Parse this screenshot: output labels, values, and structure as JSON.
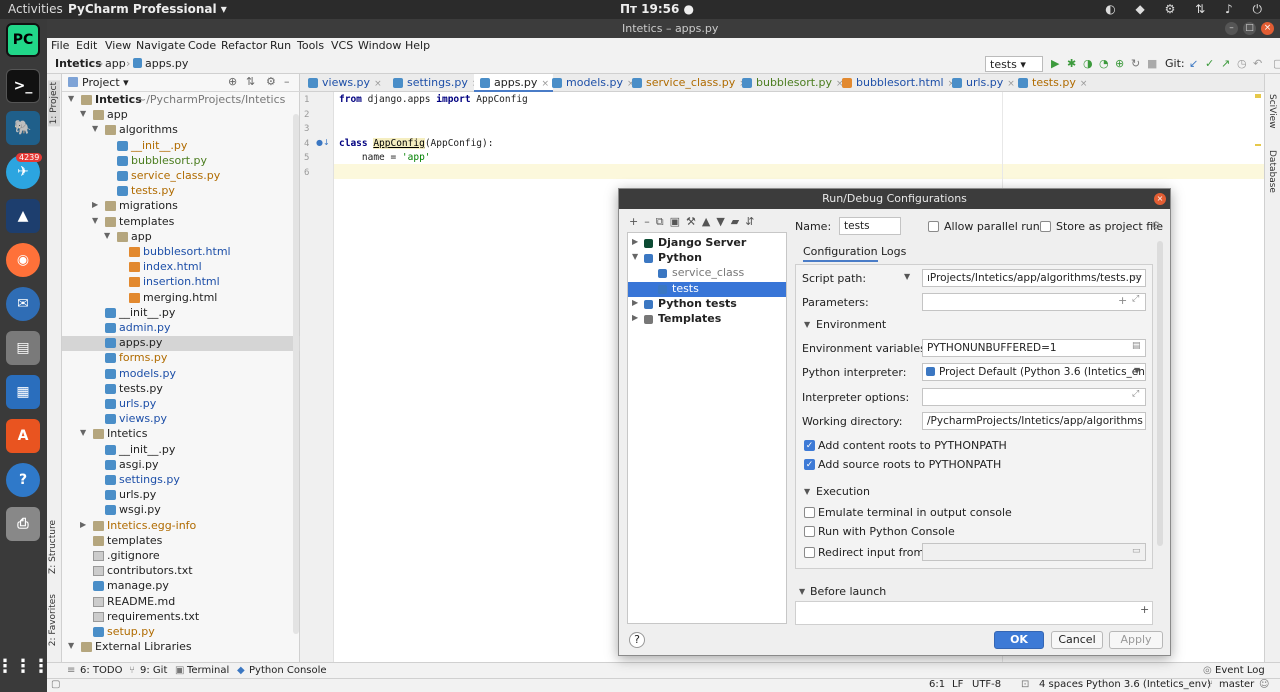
{
  "topbar": {
    "activities": "Activities",
    "app_name": "PyCharm Professional ▾",
    "clock": "Пт 19:56 ●"
  },
  "dock": {
    "telegram_badge": "4239",
    "pycharm_label": "PC"
  },
  "window": {
    "title": "Intetics – apps.py"
  },
  "menu": [
    "File",
    "Edit",
    "View",
    "Navigate",
    "Code",
    "Refactor",
    "Run",
    "Tools",
    "VCS",
    "Window",
    "Help"
  ],
  "breadcrumb": [
    "Intetics",
    "app",
    "apps.py"
  ],
  "run_config": {
    "selected": "tests ▾",
    "git_label": "Git:"
  },
  "left_tabs": {
    "project": "1: Project",
    "structure": "Z: Structure",
    "favorites": "2: Favorites"
  },
  "right_tabs": {
    "sciview": "SciView",
    "database": "Database"
  },
  "project_panel": {
    "header": "Project ▾",
    "tree": [
      {
        "label": "Intetics",
        "extra": " ~/PycharmProjects/Intetics",
        "depth": 0,
        "kind": "folder",
        "open": true,
        "color": "bold"
      },
      {
        "label": "app",
        "depth": 1,
        "kind": "folder",
        "open": true,
        "color": ""
      },
      {
        "label": "algorithms",
        "depth": 2,
        "kind": "folder",
        "open": true,
        "color": ""
      },
      {
        "label": "__init__.py",
        "depth": 3,
        "kind": "py",
        "color": "orange"
      },
      {
        "label": "bubblesort.py",
        "depth": 3,
        "kind": "py",
        "color": "green"
      },
      {
        "label": "service_class.py",
        "depth": 3,
        "kind": "py",
        "color": "orange"
      },
      {
        "label": "tests.py",
        "depth": 3,
        "kind": "py",
        "color": "orange"
      },
      {
        "label": "migrations",
        "depth": 2,
        "kind": "folder",
        "open": false,
        "color": ""
      },
      {
        "label": "templates",
        "depth": 2,
        "kind": "folder",
        "open": true,
        "color": ""
      },
      {
        "label": "app",
        "depth": 3,
        "kind": "folder",
        "open": true,
        "color": ""
      },
      {
        "label": "bubblesort.html",
        "depth": 4,
        "kind": "html",
        "color": "blue"
      },
      {
        "label": "index.html",
        "depth": 4,
        "kind": "html",
        "color": "blue"
      },
      {
        "label": "insertion.html",
        "depth": 4,
        "kind": "html",
        "color": "blue"
      },
      {
        "label": "merging.html",
        "depth": 4,
        "kind": "html",
        "color": ""
      },
      {
        "label": "__init__.py",
        "depth": 2,
        "kind": "py",
        "color": ""
      },
      {
        "label": "admin.py",
        "depth": 2,
        "kind": "py",
        "color": "blue"
      },
      {
        "label": "apps.py",
        "depth": 2,
        "kind": "py",
        "color": "",
        "selected": true
      },
      {
        "label": "forms.py",
        "depth": 2,
        "kind": "py",
        "color": "orange"
      },
      {
        "label": "models.py",
        "depth": 2,
        "kind": "py",
        "color": "blue"
      },
      {
        "label": "tests.py",
        "depth": 2,
        "kind": "py",
        "color": ""
      },
      {
        "label": "urls.py",
        "depth": 2,
        "kind": "py",
        "color": "blue"
      },
      {
        "label": "views.py",
        "depth": 2,
        "kind": "py",
        "color": "blue"
      },
      {
        "label": "Intetics",
        "depth": 1,
        "kind": "folder",
        "open": true,
        "color": ""
      },
      {
        "label": "__init__.py",
        "depth": 2,
        "kind": "py",
        "color": ""
      },
      {
        "label": "asgi.py",
        "depth": 2,
        "kind": "py",
        "color": ""
      },
      {
        "label": "settings.py",
        "depth": 2,
        "kind": "py",
        "color": "blue"
      },
      {
        "label": "urls.py",
        "depth": 2,
        "kind": "py",
        "color": ""
      },
      {
        "label": "wsgi.py",
        "depth": 2,
        "kind": "py",
        "color": ""
      },
      {
        "label": "Intetics.egg-info",
        "depth": 1,
        "kind": "folder",
        "open": false,
        "color": "orange"
      },
      {
        "label": "templates",
        "depth": 1,
        "kind": "folder",
        "color": ""
      },
      {
        "label": ".gitignore",
        "depth": 1,
        "kind": "txt",
        "color": ""
      },
      {
        "label": "contributors.txt",
        "depth": 1,
        "kind": "txt",
        "color": ""
      },
      {
        "label": "manage.py",
        "depth": 1,
        "kind": "py",
        "color": ""
      },
      {
        "label": "README.md",
        "depth": 1,
        "kind": "txt",
        "color": ""
      },
      {
        "label": "requirements.txt",
        "depth": 1,
        "kind": "txt",
        "color": ""
      },
      {
        "label": "setup.py",
        "depth": 1,
        "kind": "py",
        "color": "orange"
      },
      {
        "label": "External Libraries",
        "depth": 0,
        "kind": "folder",
        "open": true,
        "color": ""
      }
    ]
  },
  "editor_tabs": [
    {
      "label": "views.py",
      "color": "blue"
    },
    {
      "label": "settings.py",
      "color": "blue"
    },
    {
      "label": "apps.py",
      "color": "",
      "active": true
    },
    {
      "label": "models.py",
      "color": "blue"
    },
    {
      "label": "service_class.py",
      "color": "orange"
    },
    {
      "label": "bubblesort.py",
      "color": "green"
    },
    {
      "label": "bubblesort.html",
      "color": "blue"
    },
    {
      "label": "urls.py",
      "color": "blue"
    },
    {
      "label": "tests.py",
      "color": "orange"
    }
  ],
  "code": {
    "line_numbers": [
      "1",
      "2",
      "3",
      "4",
      "5",
      "6"
    ],
    "l1_kw1": "from",
    "l1_mod": " django.apps ",
    "l1_kw2": "import",
    "l1_name": " AppConfig",
    "l4_kw": "class ",
    "l4_cls": "AppConfig",
    "l4_rest": "(AppConfig):",
    "l5_name": "    name = ",
    "l5_str": "'app'"
  },
  "dialog": {
    "title": "Run/Debug Configurations",
    "tree": [
      {
        "label": "Django Server",
        "depth": 0,
        "bold": true,
        "arrow": "▶"
      },
      {
        "label": "Python",
        "depth": 0,
        "bold": true,
        "arrow": "▼"
      },
      {
        "label": "service_class",
        "depth": 1,
        "bold": false,
        "gray": true
      },
      {
        "label": "tests",
        "depth": 1,
        "bold": false,
        "selected": true
      },
      {
        "label": "Python tests",
        "depth": 0,
        "bold": true,
        "arrow": "▶"
      },
      {
        "label": "Templates",
        "depth": 0,
        "bold": true,
        "arrow": "▶"
      }
    ],
    "name_label": "Name:",
    "name_value": "tests",
    "allow_parallel": "Allow parallel run",
    "store_project": "Store as project file",
    "tab_configuration": "Configuration",
    "tab_logs": "Logs",
    "script_path_label": "Script path:",
    "script_path_value": "ıProjects/Intetics/app/algorithms/tests.py",
    "parameters_label": "Parameters:",
    "environment_section": "Environment",
    "env_vars_label": "Environment variables:",
    "env_vars_value": "PYTHONUNBUFFERED=1",
    "interpreter_label": "Python interpreter:",
    "interpreter_value": "Project Default (Python 3.6 (Intetics_env",
    "interp_options_label": "Interpreter options:",
    "working_dir_label": "Working directory:",
    "working_dir_value": "/PycharmProjects/Intetics/app/algorithms",
    "add_content_roots": "Add content roots to PYTHONPATH",
    "add_source_roots": "Add source roots to PYTHONPATH",
    "execution_section": "Execution",
    "emulate_terminal": "Emulate terminal in output console",
    "run_with_console": "Run with Python Console",
    "redirect_input": "Redirect input from:",
    "before_launch": "Before launch",
    "ok": "OK",
    "cancel": "Cancel",
    "apply": "Apply",
    "help": "?"
  },
  "bottom_tools": {
    "todo": "6: TODO",
    "git": "9: Git",
    "terminal": "Terminal",
    "console": "Python Console",
    "event_log": "Event Log"
  },
  "status": {
    "pos": "6:1",
    "lf": "LF",
    "enc": "UTF-8",
    "indent": "4 spaces",
    "interp": "Python 3.6 (Intetics_env)",
    "branch": "master"
  }
}
